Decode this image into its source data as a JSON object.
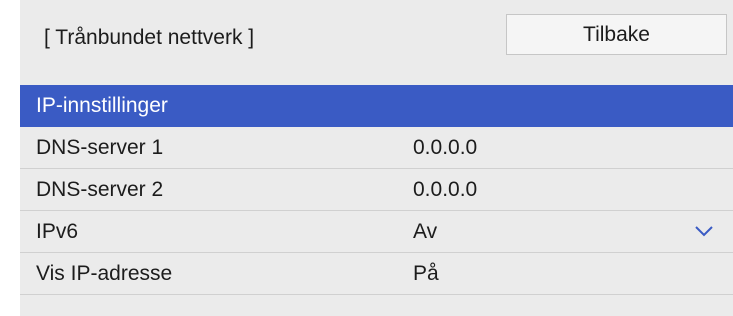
{
  "header": {
    "title": "[ Trånbundet nettverk ]",
    "back_label": "Tilbake"
  },
  "menu": {
    "items": [
      {
        "label": "IP-innstillinger",
        "value": "",
        "selected": true
      },
      {
        "label": "DNS-server 1",
        "value": "0.0.0.0"
      },
      {
        "label": "DNS-server 2",
        "value": "0.0.0.0"
      },
      {
        "label": "IPv6",
        "value": "Av",
        "icon": "chevron-down-icon"
      },
      {
        "label": "Vis IP-adresse",
        "value": "På"
      }
    ]
  },
  "colors": {
    "selection": "#3a5bc4",
    "panel_background": "#ebebeb",
    "chevron": "#3a5bc4"
  }
}
